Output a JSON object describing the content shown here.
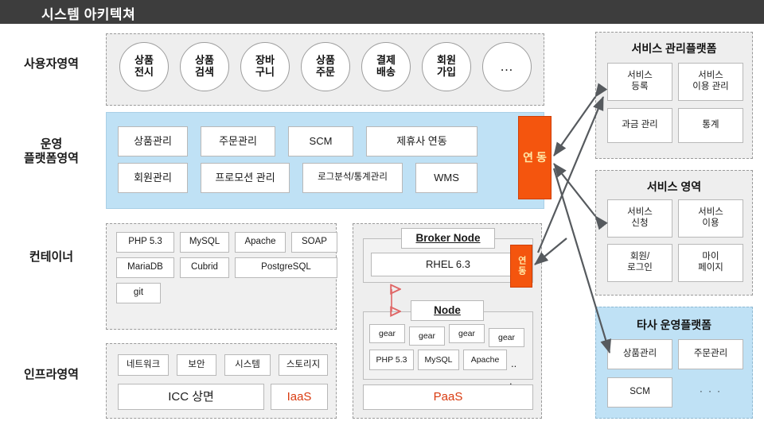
{
  "header": {
    "title": "시스템 아키텍쳐"
  },
  "rows": {
    "user": "사용자영역",
    "ops": "운영\n플랫폼영역",
    "container": "컨테이너",
    "infra": "인프라영역"
  },
  "user_area": {
    "items": [
      "상품\n전시",
      "상품\n검색",
      "장바\n구니",
      "상품\n주문",
      "결제\n배송",
      "회원\n가입",
      "…"
    ]
  },
  "ops_platform": {
    "row1": [
      "상품관리",
      "주문관리",
      "SCM",
      "제휴사 연동"
    ],
    "row2": [
      "회원관리",
      "프로모션 관리",
      "로그분석/통계관리",
      "WMS"
    ],
    "link_label": "연 동"
  },
  "container_area": {
    "row1": [
      "PHP 5.3",
      "MySQL",
      "Apache",
      "SOAP"
    ],
    "row2": [
      "MariaDB",
      "Cubrid",
      "PostgreSQL"
    ],
    "row3": [
      "git"
    ]
  },
  "paas_area": {
    "broker_title": "Broker Node",
    "broker_os": "RHEL 6.3",
    "node_title": "Node",
    "gears": [
      "gear",
      "gear",
      "gear",
      "gear"
    ],
    "stack": [
      "PHP 5.3",
      "MySQL",
      "Apache",
      ".."
    ],
    "trailing_dot": ".",
    "footer": "PaaS",
    "link_label": "연동"
  },
  "infra_area": {
    "row1": [
      "네트워크",
      "보안",
      "시스템",
      "스토리지"
    ],
    "row2": [
      "ICC 상면",
      "IaaS"
    ]
  },
  "service_mgmt_platform": {
    "title": "서비스 관리플랫폼",
    "items": [
      "서비스\n등록",
      "서비스\n이용 관리",
      "과금 관리",
      "통계"
    ]
  },
  "service_area": {
    "title": "서비스 영역",
    "items": [
      "서비스\n신청",
      "서비스\n이용",
      "회원/\n로그인",
      "마이\n페이지"
    ]
  },
  "third_party_platform": {
    "title": "타사 운영플랫폼",
    "items": [
      "상품관리",
      "주문관리",
      "SCM",
      "· · ·"
    ]
  },
  "colors": {
    "header_bg": "#3d3d3d",
    "accent_orange": "#f4550e",
    "accent_red": "#d93b10",
    "ops_blue": "#bfe1f5",
    "arrow_gray": "#565a5e"
  }
}
